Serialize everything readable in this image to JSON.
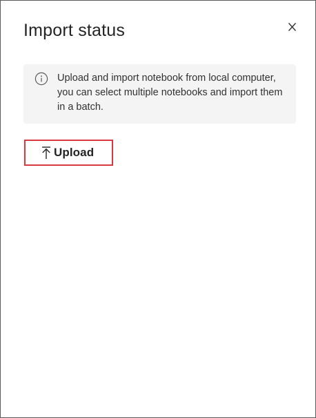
{
  "dialog": {
    "title": "Import status",
    "close_label": "X",
    "info": {
      "icon": "info-icon",
      "text": "Upload and import notebook from local computer, you can select multiple notebooks and import them in a batch."
    },
    "upload_button": {
      "icon": "upload-icon",
      "label": "Upload",
      "highlight_color": "#d9383f"
    }
  }
}
